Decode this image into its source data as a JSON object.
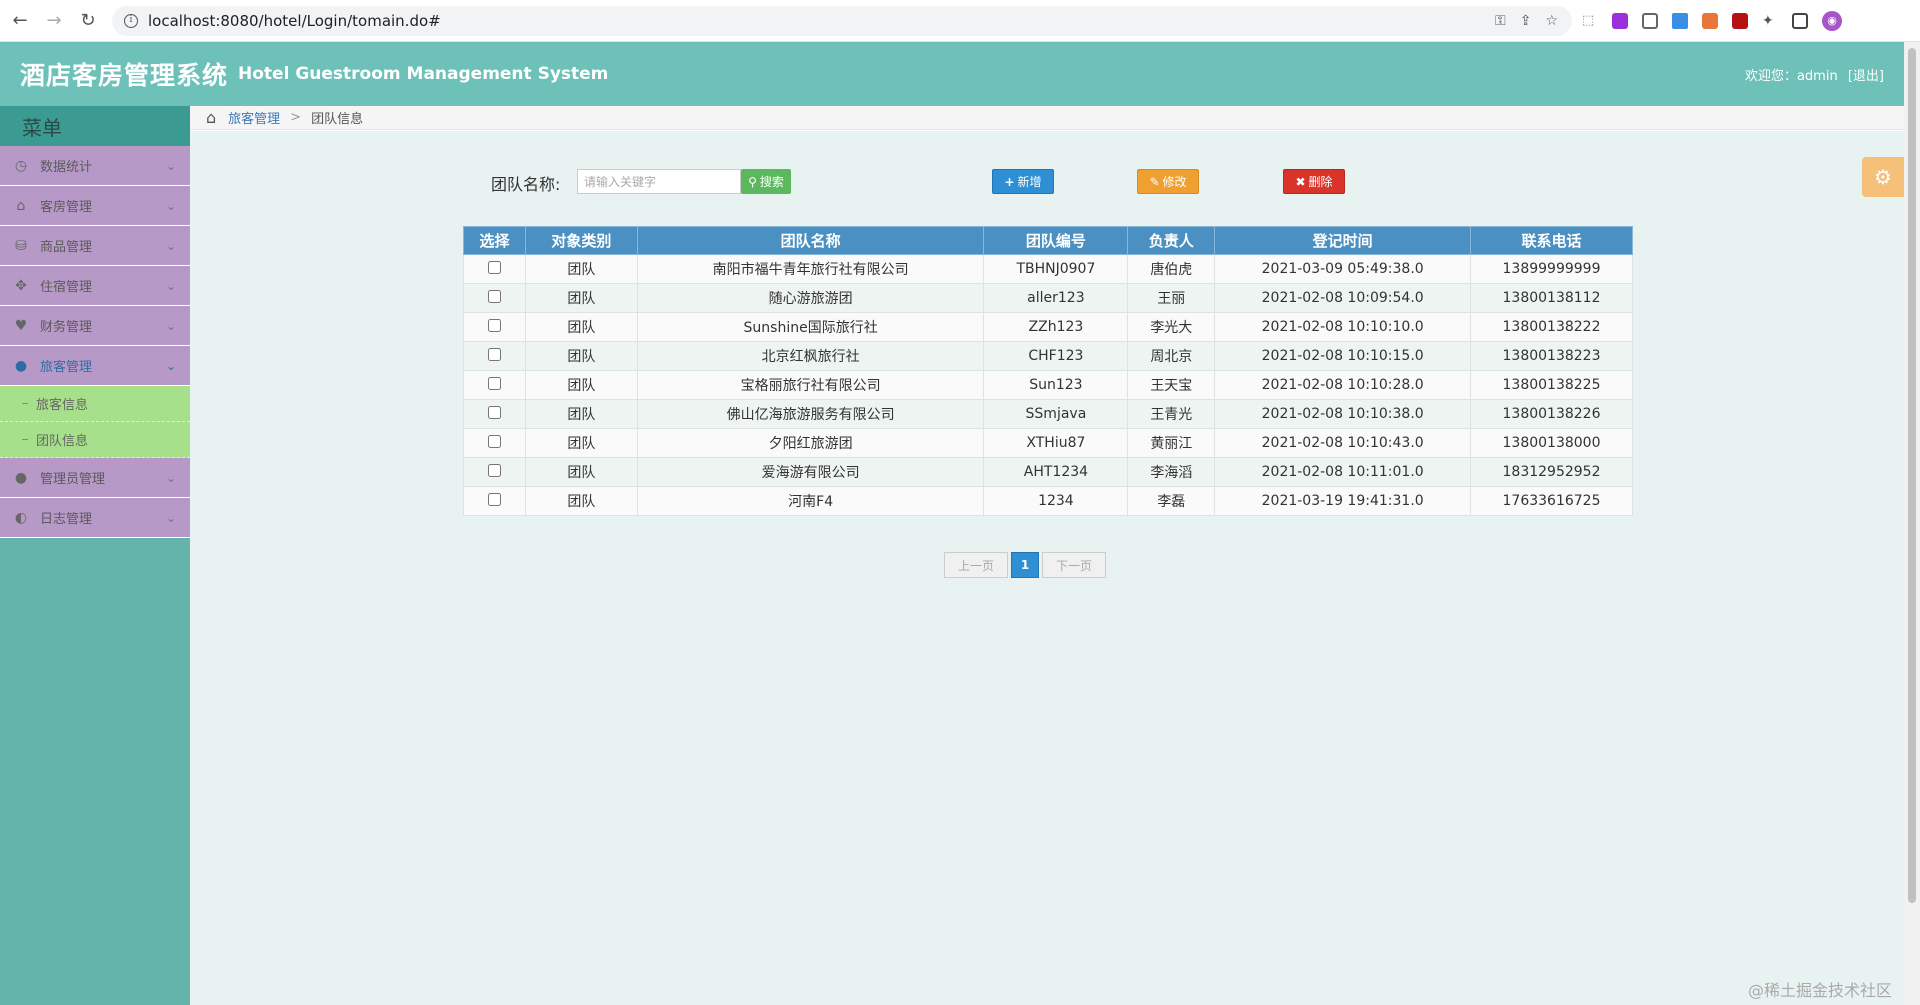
{
  "browser": {
    "url": "localhost:8080/hotel/Login/tomain.do#"
  },
  "header": {
    "title_cn": "酒店客房管理系统",
    "title_en": "Hotel Guestroom Management System",
    "welcome_text": "欢迎您：admin",
    "logout_label": "[退出]"
  },
  "sidebar": {
    "title": "菜单",
    "items": [
      {
        "label": "数据统计",
        "icon": "dashboard-icon",
        "glyph": "◷"
      },
      {
        "label": "客房管理",
        "icon": "home-icon",
        "glyph": "⌂"
      },
      {
        "label": "商品管理",
        "icon": "database-icon",
        "glyph": "⛁"
      },
      {
        "label": "住宿管理",
        "icon": "move-icon",
        "glyph": "✥"
      },
      {
        "label": "财务管理",
        "icon": "heart-icon",
        "glyph": "♥"
      },
      {
        "label": "旅客管理",
        "icon": "user-icon",
        "glyph": "👤"
      },
      {
        "label": "管理员管理",
        "icon": "user-icon",
        "glyph": "👤"
      },
      {
        "label": "日志管理",
        "icon": "half-circle-icon",
        "glyph": "◐"
      }
    ],
    "submenu": [
      {
        "label": "旅客信息"
      },
      {
        "label": "团队信息"
      }
    ]
  },
  "breadcrumb": {
    "parent": "旅客管理",
    "separator": ">",
    "current": "团队信息"
  },
  "toolbar": {
    "search_label": "团队名称:",
    "search_placeholder": "请输入关键字",
    "search_button": "搜索",
    "add_button": "新增",
    "edit_button": "修改",
    "delete_button": "删除"
  },
  "table": {
    "headers": [
      "选择",
      "对象类别",
      "团队名称",
      "团队编号",
      "负责人",
      "登记时间",
      "联系电话"
    ],
    "rows": [
      [
        "团队",
        "南阳市福牛青年旅行社有限公司",
        "TBHNJ0907",
        "唐伯虎",
        "2021-03-09 05:49:38.0",
        "13899999999"
      ],
      [
        "团队",
        "随心游旅游团",
        "aller123",
        "王丽",
        "2021-02-08 10:09:54.0",
        "13800138112"
      ],
      [
        "团队",
        "Sunshine国际旅行社",
        "ZZh123",
        "李光大",
        "2021-02-08 10:10:10.0",
        "13800138222"
      ],
      [
        "团队",
        "北京红枫旅行社",
        "CHF123",
        "周北京",
        "2021-02-08 10:10:15.0",
        "13800138223"
      ],
      [
        "团队",
        "宝格丽旅行社有限公司",
        "Sun123",
        "王天宝",
        "2021-02-08 10:10:28.0",
        "13800138225"
      ],
      [
        "团队",
        "佛山亿海旅游服务有限公司",
        "SSmjava",
        "王青光",
        "2021-02-08 10:10:38.0",
        "13800138226"
      ],
      [
        "团队",
        "夕阳红旅游团",
        "XTHiu87",
        "黄丽江",
        "2021-02-08 10:10:43.0",
        "13800138000"
      ],
      [
        "团队",
        "爱海游有限公司",
        "AHT1234",
        "李海滔",
        "2021-02-08 10:11:01.0",
        "18312952952"
      ],
      [
        "团队",
        "河南F4",
        "1234",
        "李磊",
        "2021-03-19 19:41:31.0",
        "17633616725"
      ]
    ]
  },
  "pager": {
    "prev": "上一页",
    "current": "1",
    "next": "下一页"
  },
  "watermark": "@稀土掘金技术社区",
  "colors": {
    "header_bg": "#6dc1b8",
    "sidebar_bg": "#64b4ac",
    "menu_bg": "#b799c8",
    "submenu_bg": "#a7e08a",
    "table_header": "#4a90c2"
  }
}
